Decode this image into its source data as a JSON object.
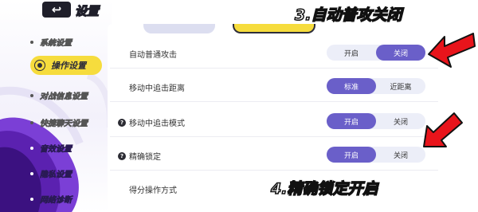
{
  "sidebar": {
    "title": "设置",
    "items": [
      {
        "label": "系统设置"
      },
      {
        "label": "操作设置",
        "active": true
      },
      {
        "label": "对战信息设置"
      },
      {
        "label": "快捷聊天设置"
      },
      {
        "label": "音效设置"
      },
      {
        "label": "隐私设置"
      },
      {
        "label": "网络诊断"
      }
    ]
  },
  "settings": [
    {
      "label": "自动普通攻击",
      "help": false,
      "options": [
        "开启",
        "关闭"
      ],
      "selected": 1
    },
    {
      "label": "移动中追击距离",
      "help": false,
      "options": [
        "标准",
        "近距离"
      ],
      "selected": 0
    },
    {
      "label": "移动中追击模式",
      "help": true,
      "options": [
        "开启",
        "关闭"
      ],
      "selected": 0
    },
    {
      "label": "精确锁定",
      "help": true,
      "options": [
        "开启",
        "关闭"
      ],
      "selected": 0
    },
    {
      "label": "得分操作方式",
      "help": false,
      "options": [],
      "selected": null
    }
  ],
  "annotations": {
    "step3": "3.自动普攻关闭",
    "step4": "4.精确锁定开启"
  },
  "colors": {
    "accent_purple": "#6a5fc9",
    "active_yellow": "#f6dc3d",
    "arrow_red": "#e8141b",
    "sidebar_purple": "#7b3fd6"
  }
}
